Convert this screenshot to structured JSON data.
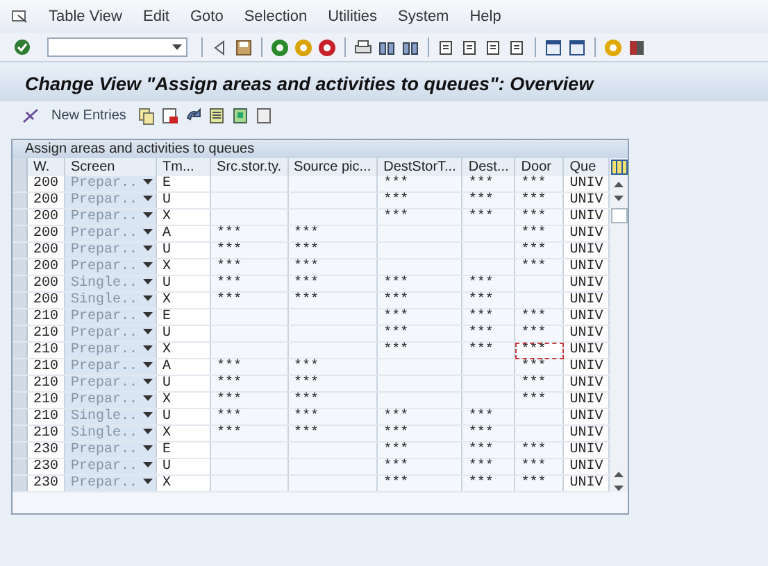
{
  "menu_bar": [
    "Table View",
    "Edit",
    "Goto",
    "Selection",
    "Utilities",
    "System",
    "Help"
  ],
  "title": "Change View \"Assign areas and activities to queues\": Overview",
  "app_toolbar": {
    "new_entries": "New Entries"
  },
  "table": {
    "caption": "Assign areas and activities to queues",
    "columns": [
      "W.",
      "Screen",
      "Tm...",
      "Src.stor.ty.",
      "Source pic...",
      "DestStorT...",
      "Dest...",
      "Door",
      "Que"
    ],
    "rows": [
      {
        "cells": [
          "200",
          "Prepar..",
          "E",
          "",
          "",
          "***",
          "***",
          "***",
          "UNIV"
        ],
        "focused": false
      },
      {
        "cells": [
          "200",
          "Prepar..",
          "U",
          "",
          "",
          "***",
          "***",
          "***",
          "UNIV"
        ],
        "focused": false
      },
      {
        "cells": [
          "200",
          "Prepar..",
          "X",
          "",
          "",
          "***",
          "***",
          "***",
          "UNIV"
        ],
        "focused": false
      },
      {
        "cells": [
          "200",
          "Prepar..",
          "A",
          "***",
          "***",
          "",
          "",
          "***",
          "UNIV"
        ],
        "focused": false
      },
      {
        "cells": [
          "200",
          "Prepar..",
          "U",
          "***",
          "***",
          "",
          "",
          "***",
          "UNIV"
        ],
        "focused": false
      },
      {
        "cells": [
          "200",
          "Prepar..",
          "X",
          "***",
          "***",
          "",
          "",
          "***",
          "UNIV"
        ],
        "focused": false
      },
      {
        "cells": [
          "200",
          "Single..",
          "U",
          "***",
          "***",
          "***",
          "***",
          "",
          "UNIV"
        ],
        "focused": false
      },
      {
        "cells": [
          "200",
          "Single..",
          "X",
          "***",
          "***",
          "***",
          "***",
          "",
          "UNIV"
        ],
        "focused": false
      },
      {
        "cells": [
          "210",
          "Prepar..",
          "E",
          "",
          "",
          "***",
          "***",
          "***",
          "UNIV"
        ],
        "focused": false
      },
      {
        "cells": [
          "210",
          "Prepar..",
          "U",
          "",
          "",
          "***",
          "***",
          "***",
          "UNIV"
        ],
        "focused": false
      },
      {
        "cells": [
          "210",
          "Prepar..",
          "X",
          "",
          "",
          "***",
          "***",
          "***",
          "UNIV"
        ],
        "focused": true
      },
      {
        "cells": [
          "210",
          "Prepar..",
          "A",
          "***",
          "***",
          "",
          "",
          "***",
          "UNIV"
        ],
        "focused": false
      },
      {
        "cells": [
          "210",
          "Prepar..",
          "U",
          "***",
          "***",
          "",
          "",
          "***",
          "UNIV"
        ],
        "focused": false
      },
      {
        "cells": [
          "210",
          "Prepar..",
          "X",
          "***",
          "***",
          "",
          "",
          "***",
          "UNIV"
        ],
        "focused": false
      },
      {
        "cells": [
          "210",
          "Single..",
          "U",
          "***",
          "***",
          "***",
          "***",
          "",
          "UNIV"
        ],
        "focused": false
      },
      {
        "cells": [
          "210",
          "Single..",
          "X",
          "***",
          "***",
          "***",
          "***",
          "",
          "UNIV"
        ],
        "focused": false
      },
      {
        "cells": [
          "230",
          "Prepar..",
          "E",
          "",
          "",
          "***",
          "***",
          "***",
          "UNIV"
        ],
        "focused": false
      },
      {
        "cells": [
          "230",
          "Prepar..",
          "U",
          "",
          "",
          "***",
          "***",
          "***",
          "UNIV"
        ],
        "focused": false
      },
      {
        "cells": [
          "230",
          "Prepar..",
          "X",
          "",
          "",
          "***",
          "***",
          "***",
          "UNIV"
        ],
        "focused": false
      }
    ]
  }
}
